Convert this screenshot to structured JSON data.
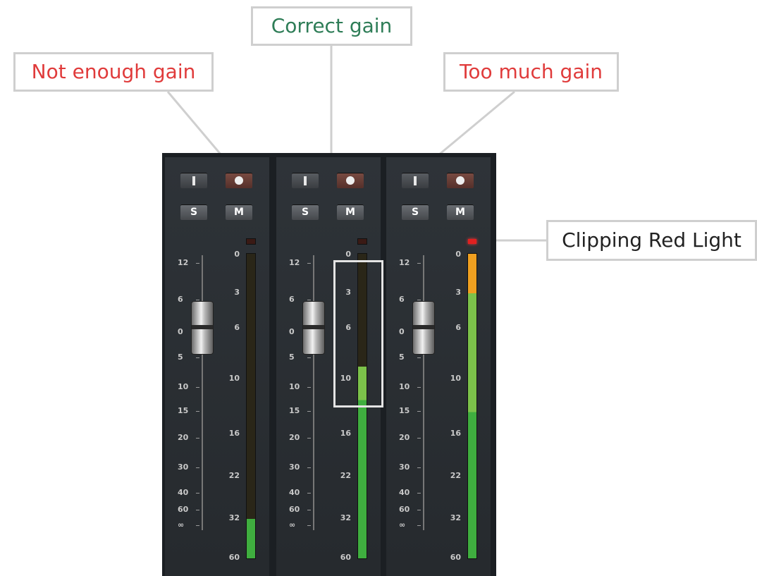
{
  "callouts": {
    "not_enough": {
      "text": "Not enough gain",
      "color": "#e03b3b"
    },
    "correct": {
      "text": "Correct gain",
      "color": "#2e7d57"
    },
    "too_much": {
      "text": "Too much gain",
      "color": "#e03b3b"
    },
    "clipping": {
      "text": "Clipping Red Light",
      "color": "#222222"
    }
  },
  "buttons": {
    "input_label": "I",
    "record_icon": "record-dot",
    "solo_label": "S",
    "mute_label": "M"
  },
  "fader_scale": [
    "12",
    "6",
    "0",
    "5",
    "10",
    "15",
    "20",
    "30",
    "40",
    "60",
    "∞"
  ],
  "meter_scale": [
    "0",
    "3",
    "6",
    "10",
    "16",
    "22",
    "32",
    "60"
  ],
  "meter_scale_center": [
    "0",
    "3",
    "6",
    "10",
    "16",
    "22",
    "32",
    "60"
  ],
  "channels": [
    {
      "name": "not-enough-gain",
      "fader_level_db": "0",
      "meter_level_fraction": 0.13,
      "clipping": false
    },
    {
      "name": "correct-gain",
      "fader_level_db": "0",
      "meter_level_fraction": 0.63,
      "clipping": false
    },
    {
      "name": "too-much-gain",
      "fader_level_db": "0",
      "meter_level_fraction": 1.0,
      "clipping": true
    }
  ],
  "colors": {
    "meter_green": "#3fae3f",
    "meter_light_green": "#7cc24a",
    "meter_orange": "#f0a020",
    "clip_red": "#e02020"
  }
}
